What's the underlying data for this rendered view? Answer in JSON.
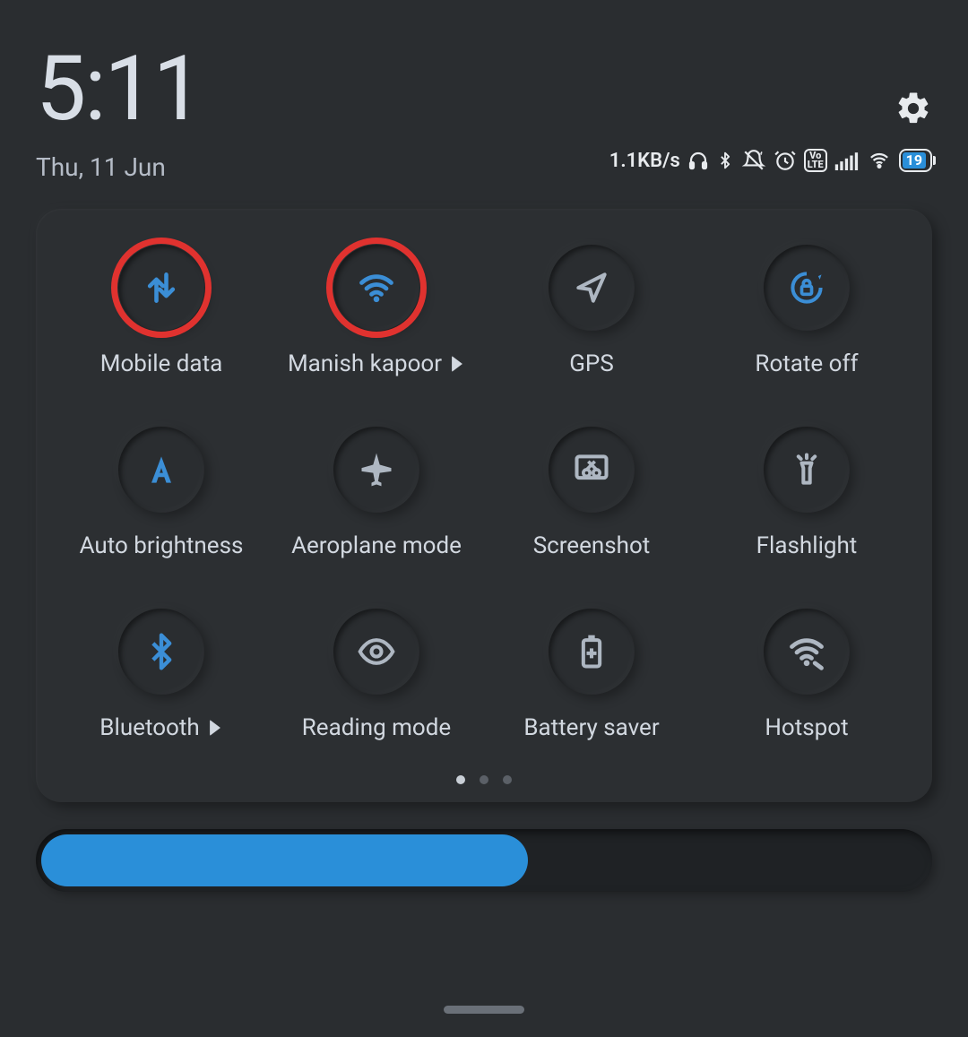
{
  "header": {
    "time": "5:11",
    "date": "Thu, 11 Jun"
  },
  "status": {
    "net_speed": "1.1KB/s",
    "battery_percent": "19",
    "volte": "Vo\nLTE"
  },
  "tiles": [
    {
      "key": "mobile-data",
      "label": "Mobile data",
      "icon": "mobile-data-icon",
      "active": true,
      "highlight": true,
      "chevron": false
    },
    {
      "key": "wifi",
      "label": "Manish kapoor",
      "icon": "wifi-icon",
      "active": true,
      "highlight": true,
      "chevron": true
    },
    {
      "key": "gps",
      "label": "GPS",
      "icon": "gps-icon",
      "active": false,
      "highlight": false,
      "chevron": false
    },
    {
      "key": "rotate-off",
      "label": "Rotate off",
      "icon": "rotate-lock-icon",
      "active": true,
      "highlight": false,
      "chevron": false
    },
    {
      "key": "auto-brightness",
      "label": "Auto brightness",
      "icon": "auto-brightness-icon",
      "active": true,
      "highlight": false,
      "chevron": false
    },
    {
      "key": "aeroplane",
      "label": "Aeroplane mode",
      "icon": "airplane-icon",
      "active": false,
      "highlight": false,
      "chevron": false
    },
    {
      "key": "screenshot",
      "label": "Screenshot",
      "icon": "screenshot-icon",
      "active": false,
      "highlight": false,
      "chevron": false
    },
    {
      "key": "flashlight",
      "label": "Flashlight",
      "icon": "flashlight-icon",
      "active": false,
      "highlight": false,
      "chevron": false
    },
    {
      "key": "bluetooth",
      "label": "Bluetooth",
      "icon": "bluetooth-icon",
      "active": true,
      "highlight": false,
      "chevron": true
    },
    {
      "key": "reading-mode",
      "label": "Reading mode",
      "icon": "eye-icon",
      "active": false,
      "highlight": false,
      "chevron": false
    },
    {
      "key": "battery-saver",
      "label": "Battery saver",
      "icon": "battery-plus-icon",
      "active": false,
      "highlight": false,
      "chevron": false
    },
    {
      "key": "hotspot",
      "label": "Hotspot",
      "icon": "hotspot-icon",
      "active": false,
      "highlight": false,
      "chevron": false
    }
  ],
  "pagination": {
    "count": 3,
    "active": 0
  },
  "brightness_percent": 55
}
